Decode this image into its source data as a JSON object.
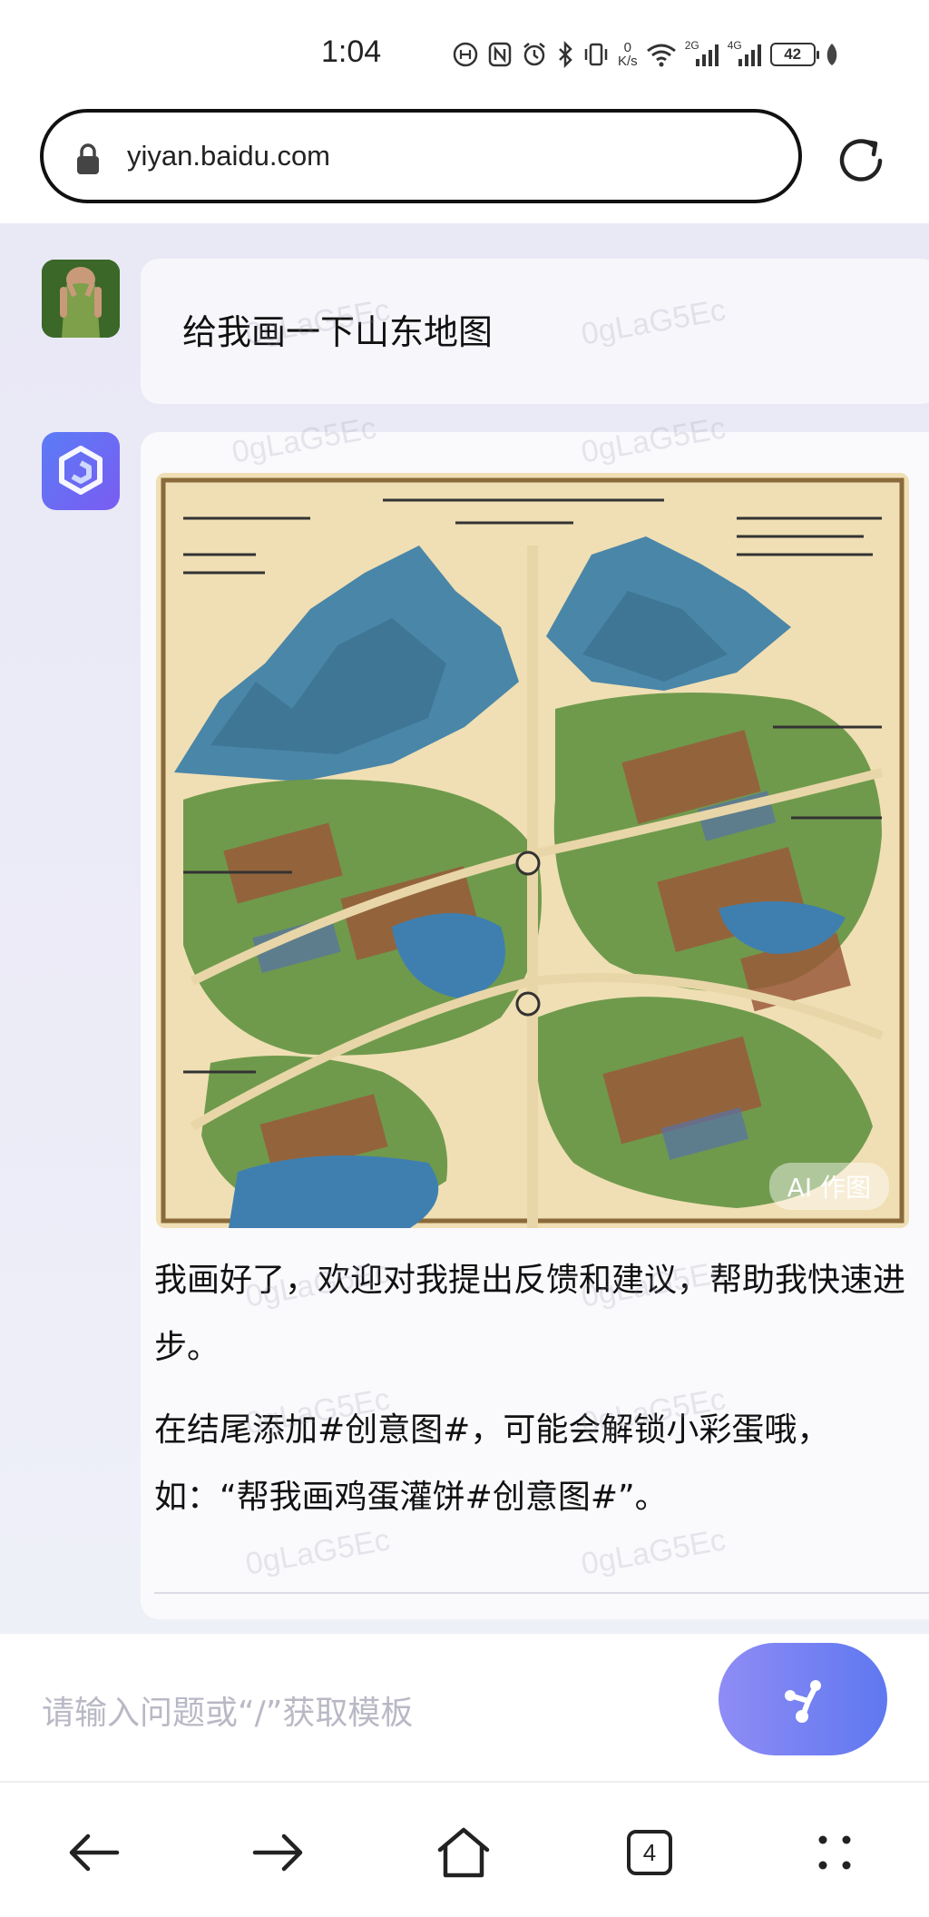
{
  "status_bar": {
    "time": "1:04",
    "net_speed_value": "0",
    "net_speed_unit": "K/s",
    "sim1_label": "2G",
    "sim2_label": "4G",
    "battery": "42"
  },
  "browser": {
    "url": "yiyan.baidu.com"
  },
  "chat": {
    "user_message": "给我画一下山东地图",
    "bot_image_badge": "AI 作图",
    "bot_reply_p1": "我画好了，欢迎对我提出反馈和建议，帮助我快速进步。",
    "bot_reply_p2": "在结尾添加#创意图#，可能会解锁小彩蛋哦，如：“帮我画鸡蛋灌饼#创意图#”。",
    "watermark": "0gLaG5Ec"
  },
  "input": {
    "placeholder": "请输入问题或“/”获取模板"
  },
  "nav": {
    "tab_count": "4"
  },
  "colors": {
    "accent": "#6b7ff2",
    "bot_avatar": "#5b7cf6",
    "chat_bg": "#ebeaf7"
  }
}
